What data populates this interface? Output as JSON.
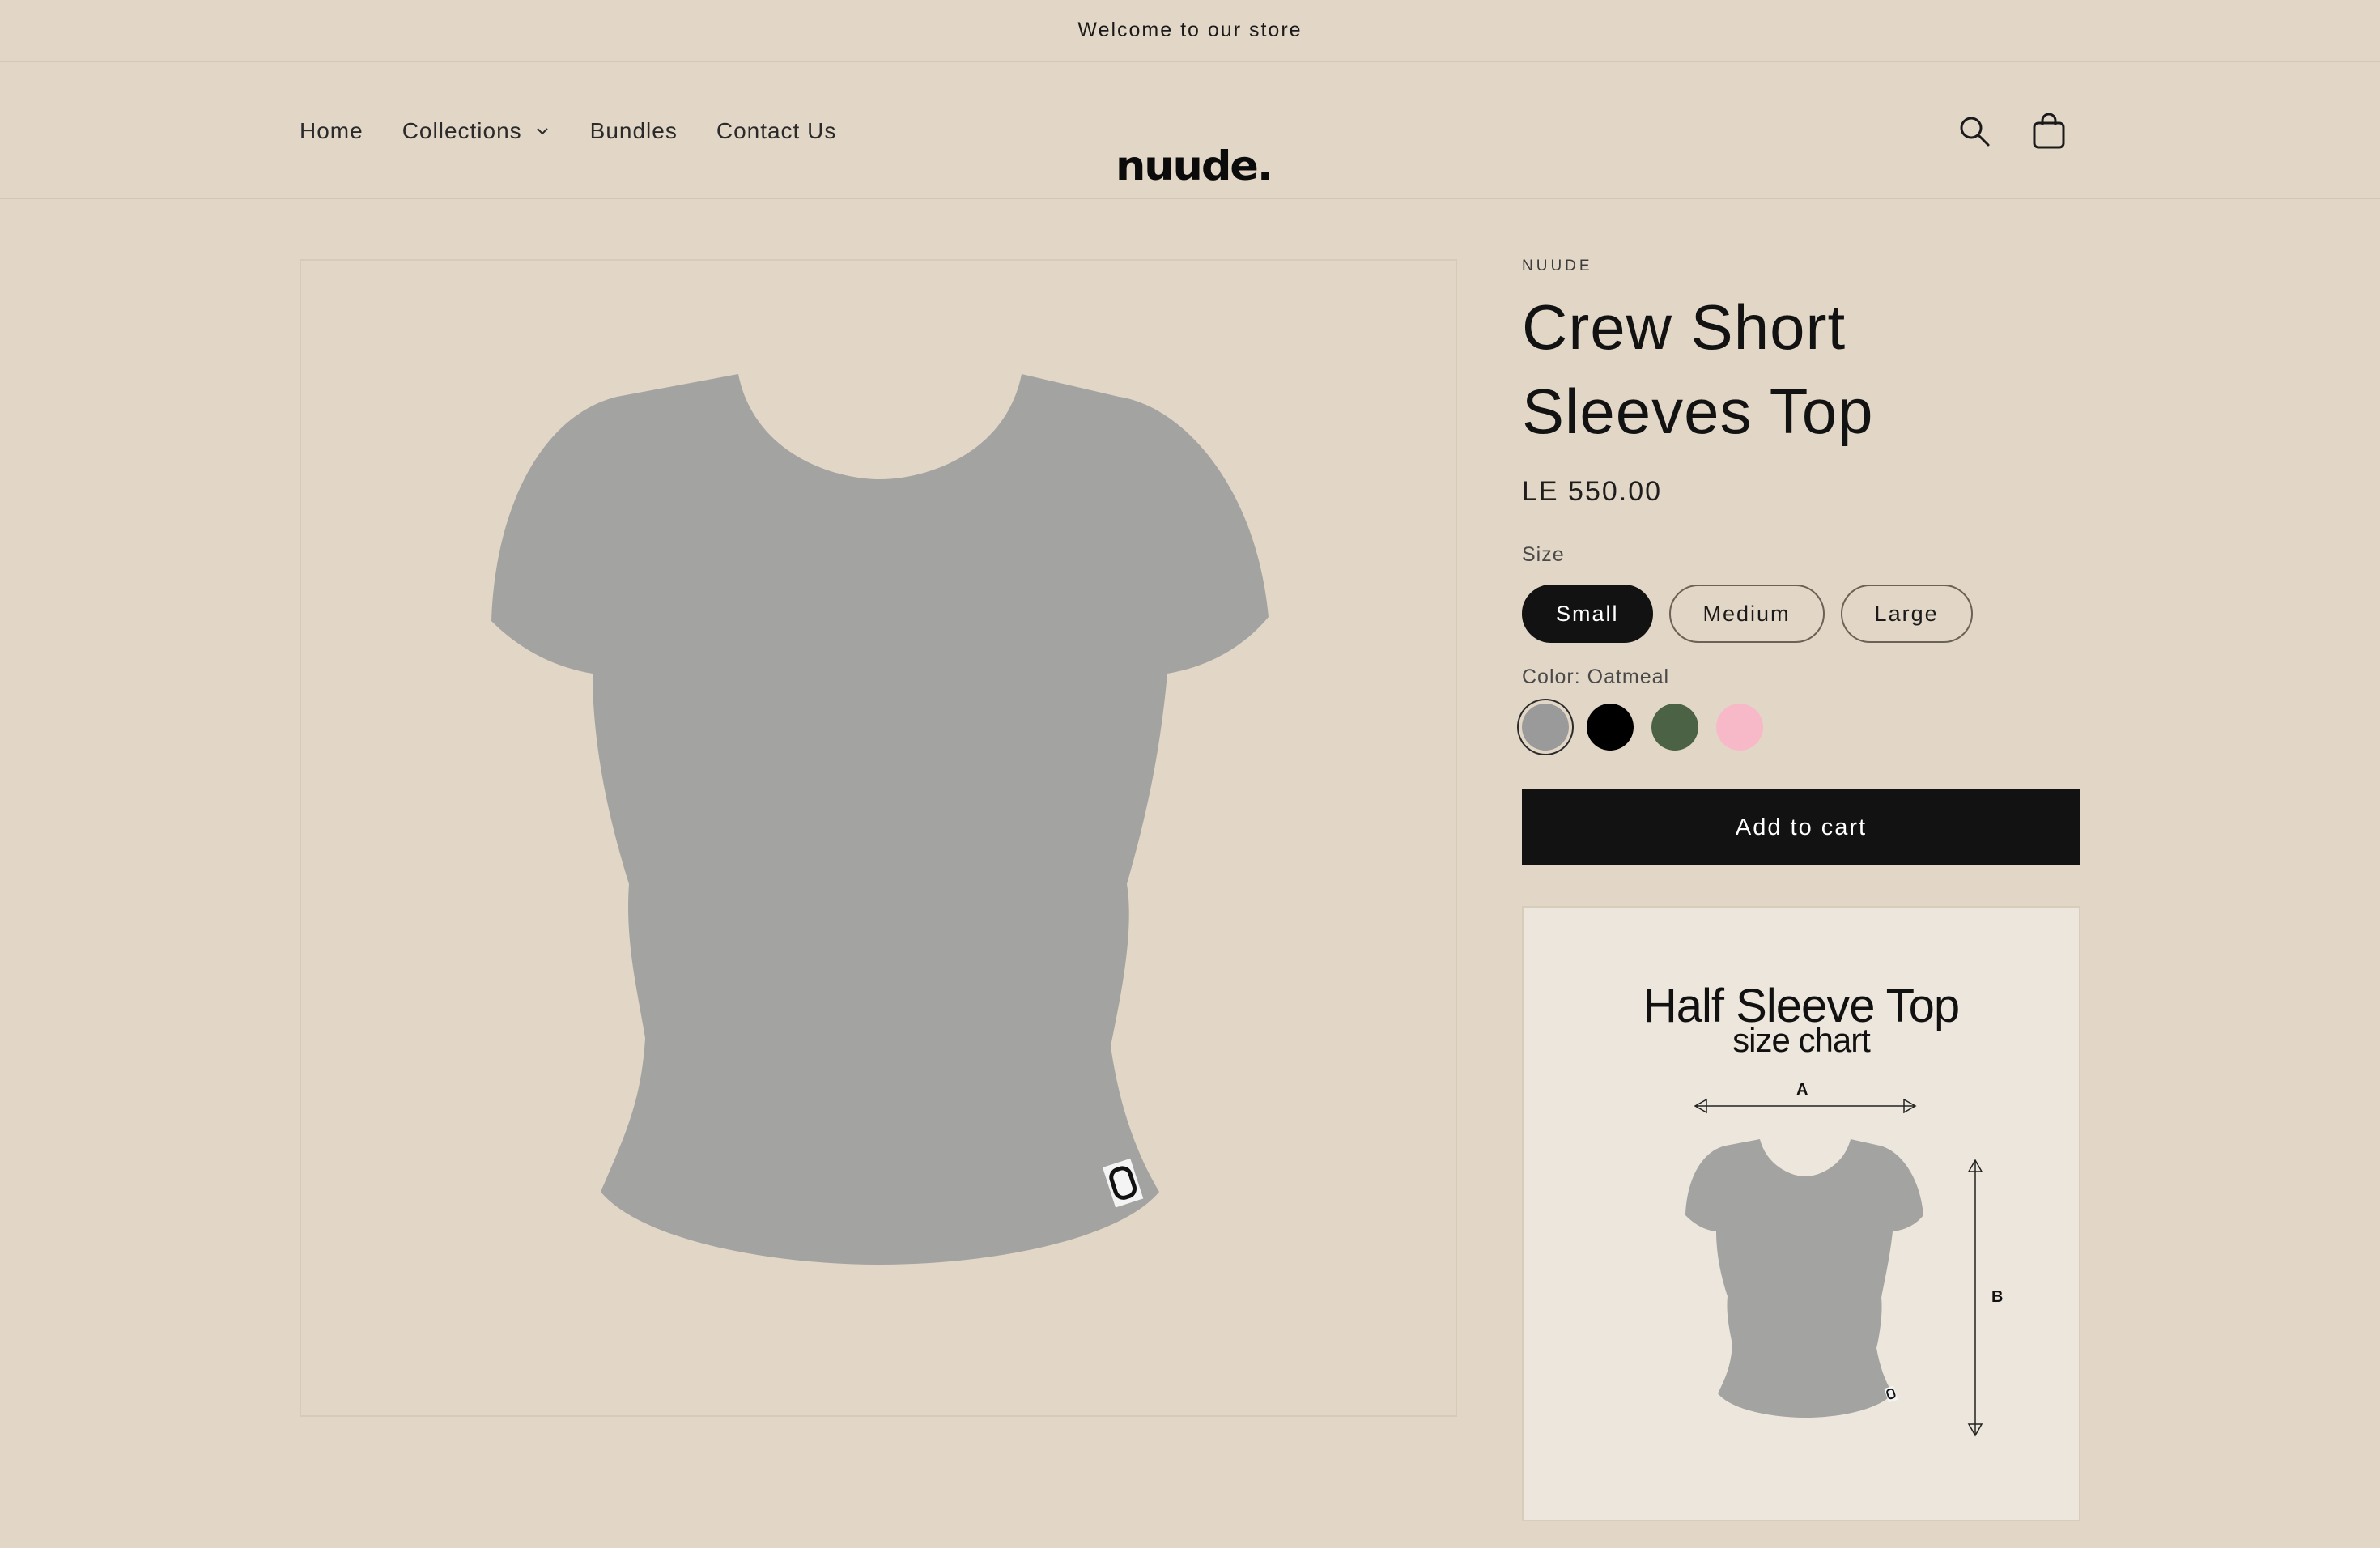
{
  "announcement": {
    "text": "Welcome to our store"
  },
  "nav": {
    "items": [
      {
        "label": "Home"
      },
      {
        "label": "Collections",
        "has_dropdown": true
      },
      {
        "label": "Bundles"
      },
      {
        "label": "Contact Us"
      }
    ]
  },
  "logo": {
    "text": "nuude."
  },
  "header_icons": [
    "search-icon",
    "cart-icon"
  ],
  "product": {
    "vendor": "NUUDE",
    "title": "Crew Short Sleeves Top",
    "price": "LE 550.00",
    "size_label": "Size",
    "sizes": [
      "Small",
      "Medium",
      "Large"
    ],
    "selected_size": "Small",
    "color_label": "Color: Oatmeal",
    "colors": [
      "#9a9a9a",
      "#000000",
      "#4b6245",
      "#f7b9c8"
    ],
    "selected_color_index": 0,
    "add_to_cart": "Add to cart"
  },
  "size_chart": {
    "title": "Half Sleeve Top",
    "subtitle": "size chart",
    "label_a": "A",
    "label_b": "B"
  },
  "colors": {
    "background": "#e2d7c6",
    "accent": "#121212",
    "garment": "#a3a3a1"
  }
}
